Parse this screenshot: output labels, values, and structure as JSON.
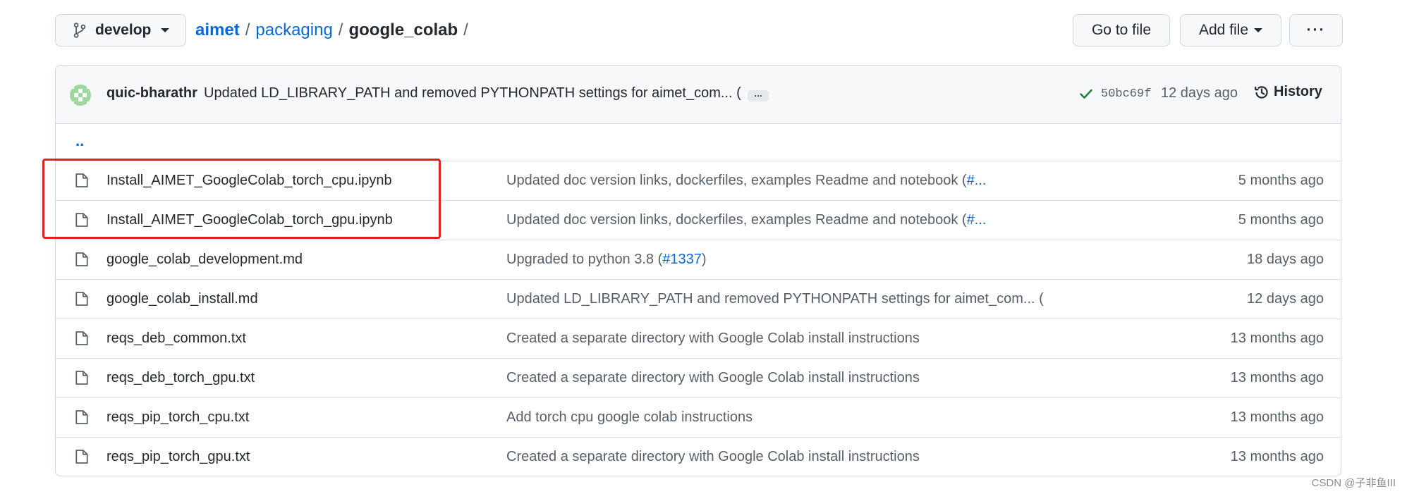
{
  "toolbar": {
    "branch": "develop",
    "breadcrumb": {
      "root": "aimet",
      "parts": [
        "packaging",
        "google_colab"
      ],
      "separator": "/"
    },
    "goto_file_label": "Go to file",
    "add_file_label": "Add file",
    "more_label": "···"
  },
  "latest_commit": {
    "author": "quic-bharathr",
    "message": "Updated LD_LIBRARY_PATH and removed PYTHONPATH settings for aimet_com... (",
    "ellipsis": "…",
    "status": "success",
    "sha": "50bc69f",
    "time": "12 days ago",
    "history_label": "History"
  },
  "parent_dir_label": "..",
  "files": [
    {
      "name": "Install_AIMET_GoogleColab_torch_cpu.ipynb",
      "commit_message": "Updated doc version links, dockerfiles, examples Readme and notebook (",
      "commit_issue": "#...",
      "commit_suffix": "",
      "age": "5 months ago",
      "highlighted": true
    },
    {
      "name": "Install_AIMET_GoogleColab_torch_gpu.ipynb",
      "commit_message": "Updated doc version links, dockerfiles, examples Readme and notebook (",
      "commit_issue": "#...",
      "commit_suffix": "",
      "age": "5 months ago",
      "highlighted": true
    },
    {
      "name": "google_colab_development.md",
      "commit_message": "Upgraded to python 3.8 (",
      "commit_issue": "#1337",
      "commit_suffix": ")",
      "age": "18 days ago",
      "highlighted": false
    },
    {
      "name": "google_colab_install.md",
      "commit_message": "Updated LD_LIBRARY_PATH and removed PYTHONPATH settings for aimet_com... (",
      "commit_issue": "",
      "commit_suffix": "",
      "age": "12 days ago",
      "highlighted": false
    },
    {
      "name": "reqs_deb_common.txt",
      "commit_message": "Created a separate directory with Google Colab install instructions",
      "commit_issue": "",
      "commit_suffix": "",
      "age": "13 months ago",
      "highlighted": false
    },
    {
      "name": "reqs_deb_torch_gpu.txt",
      "commit_message": "Created a separate directory with Google Colab install instructions",
      "commit_issue": "",
      "commit_suffix": "",
      "age": "13 months ago",
      "highlighted": false
    },
    {
      "name": "reqs_pip_torch_cpu.txt",
      "commit_message": "Add torch cpu google colab instructions",
      "commit_issue": "",
      "commit_suffix": "",
      "age": "13 months ago",
      "highlighted": false
    },
    {
      "name": "reqs_pip_torch_gpu.txt",
      "commit_message": "Created a separate directory with Google Colab install instructions",
      "commit_issue": "",
      "commit_suffix": "",
      "age": "13 months ago",
      "highlighted": false
    }
  ],
  "watermark": "CSDN @子非鱼III",
  "colors": {
    "link": "#0969da",
    "text": "#24292f",
    "muted": "#57606a",
    "border": "#d0d7de",
    "header_bg": "#f6f8fa",
    "success": "#1a7f37",
    "highlight": "#e32119"
  },
  "icons": {
    "branch": "git-branch-icon",
    "file": "file-icon",
    "check": "check-icon",
    "history": "history-icon",
    "avatar": "identicon-avatar"
  }
}
